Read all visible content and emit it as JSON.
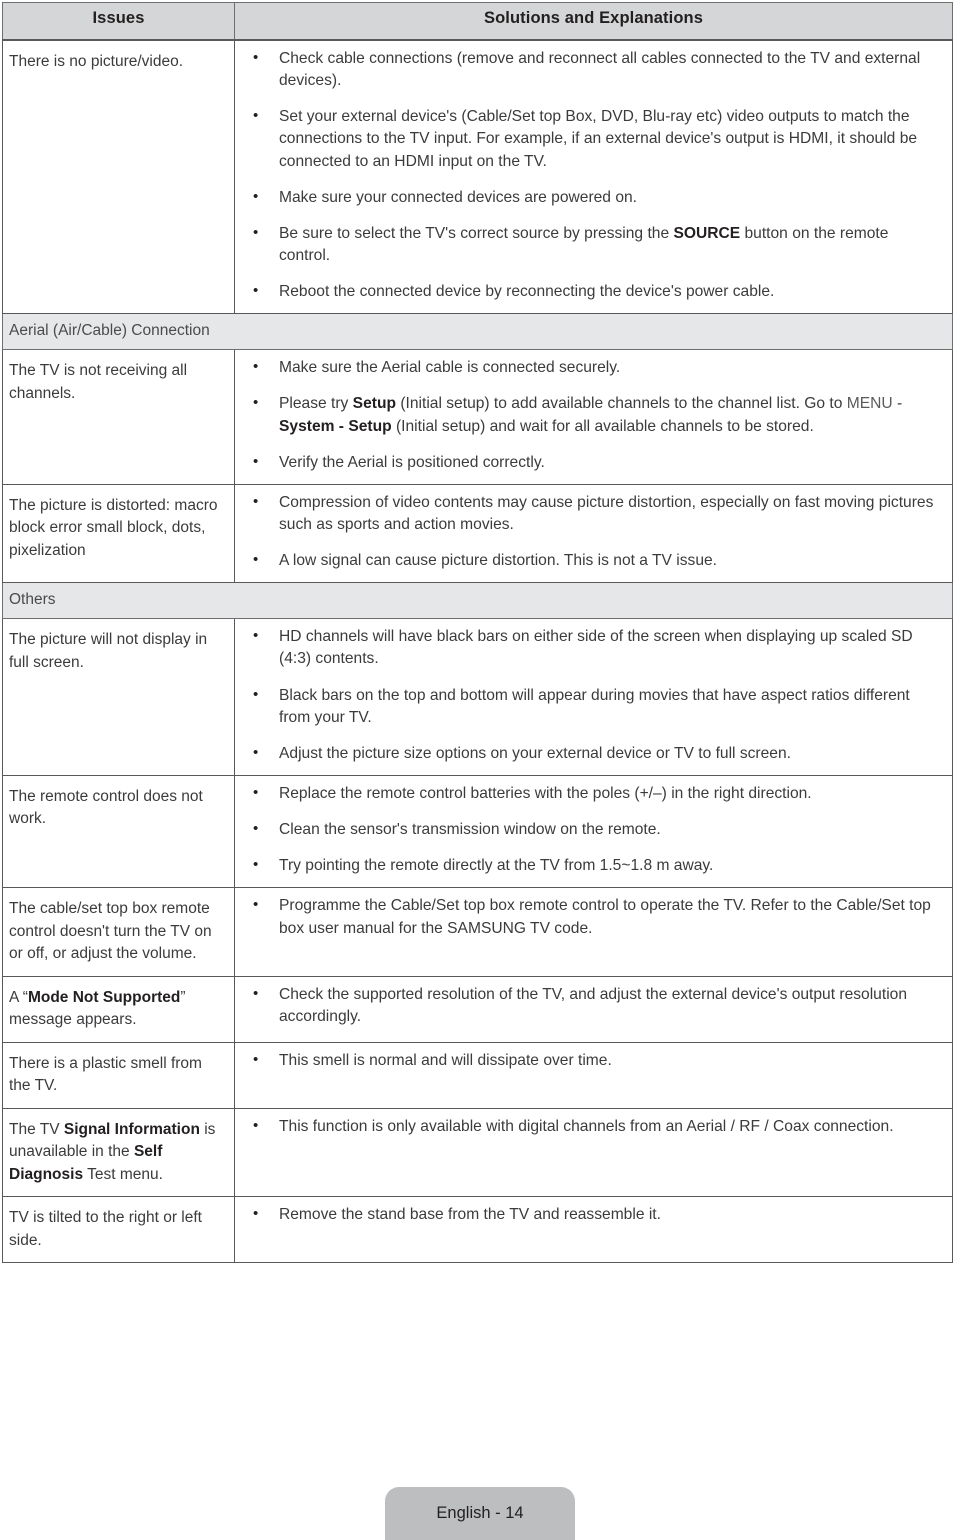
{
  "table": {
    "headers": {
      "issues": "Issues",
      "solutions": "Solutions and Explanations"
    },
    "sections": [
      {
        "label": "",
        "rows": [
          {
            "issue_parts": [
              {
                "text": "There is no picture/video.",
                "bold": false
              }
            ],
            "solutions": [
              [
                {
                  "text": "Check cable connections (remove and reconnect all cables connected to the TV and external devices).",
                  "style": "normal"
                }
              ],
              [
                {
                  "text": "Set your external device's (Cable/Set top Box, DVD, Blu-ray etc) video outputs to match the connections to the TV input. For example, if an external device's output is HDMI, it should be connected to an HDMI input on the TV.",
                  "style": "normal"
                }
              ],
              [
                {
                  "text": "Make sure your connected devices are powered on.",
                  "style": "normal"
                }
              ],
              [
                {
                  "text": "Be sure to select the TV's correct source by pressing the ",
                  "style": "normal"
                },
                {
                  "text": "SOURCE",
                  "style": "bold"
                },
                {
                  "text": " button on the remote control.",
                  "style": "normal"
                }
              ],
              [
                {
                  "text": "Reboot the connected device by reconnecting the device's power cable.",
                  "style": "normal"
                }
              ]
            ]
          }
        ]
      },
      {
        "label": "Aerial (Air/Cable) Connection",
        "rows": [
          {
            "issue_parts": [
              {
                "text": "The TV is not receiving all channels.",
                "bold": false
              }
            ],
            "solutions": [
              [
                {
                  "text": "Make sure the Aerial cable is connected securely.",
                  "style": "normal"
                }
              ],
              [
                {
                  "text": "Please try ",
                  "style": "normal"
                },
                {
                  "text": "Setup",
                  "style": "bold"
                },
                {
                  "text": " (Initial setup) to add available channels to the channel list. Go to ",
                  "style": "normal"
                },
                {
                  "text": "MENU",
                  "style": "light"
                },
                {
                  "text": " - ",
                  "style": "normal"
                },
                {
                  "text": "System - Setup",
                  "style": "bold"
                },
                {
                  "text": " (Initial setup) and wait for all available channels to be stored.",
                  "style": "normal"
                }
              ],
              [
                {
                  "text": "Verify the Aerial is positioned correctly.",
                  "style": "normal"
                }
              ]
            ]
          },
          {
            "issue_parts": [
              {
                "text": "The picture is distorted: macro block error small block, dots, pixelization",
                "bold": false
              }
            ],
            "solutions": [
              [
                {
                  "text": "Compression of video contents may cause picture distortion, especially on fast moving pictures such as sports and action movies.",
                  "style": "normal"
                }
              ],
              [
                {
                  "text": "A low signal can cause picture distortion. This is not a TV issue.",
                  "style": "normal"
                }
              ]
            ]
          }
        ]
      },
      {
        "label": "Others",
        "rows": [
          {
            "issue_parts": [
              {
                "text": "The picture will not display in full screen.",
                "bold": false
              }
            ],
            "solutions": [
              [
                {
                  "text": "HD channels will have black bars on either side of the screen when displaying up scaled SD (4:3) contents.",
                  "style": "normal"
                }
              ],
              [
                {
                  "text": "Black bars on the top and bottom will appear during movies that have aspect ratios different from your TV.",
                  "style": "normal"
                }
              ],
              [
                {
                  "text": "Adjust the picture size options on your external device or TV to full screen.",
                  "style": "normal"
                }
              ]
            ]
          },
          {
            "issue_parts": [
              {
                "text": "The remote control does not work.",
                "bold": false
              }
            ],
            "solutions": [
              [
                {
                  "text": "Replace the remote control batteries with the poles (+/–) in the right direction.",
                  "style": "normal"
                }
              ],
              [
                {
                  "text": "Clean the sensor's transmission window on the remote.",
                  "style": "normal"
                }
              ],
              [
                {
                  "text": "Try pointing the remote directly at the TV from 1.5~1.8 m away.",
                  "style": "normal"
                }
              ]
            ]
          },
          {
            "issue_parts": [
              {
                "text": "The cable/set top box remote control doesn't turn the TV on or off, or adjust the volume.",
                "bold": false
              }
            ],
            "solutions": [
              [
                {
                  "text": "Programme the Cable/Set top box remote control to operate the TV. Refer to the Cable/Set top box user manual for the SAMSUNG TV code.",
                  "style": "normal"
                }
              ]
            ]
          },
          {
            "issue_parts": [
              {
                "text": "A “",
                "bold": false
              },
              {
                "text": "Mode Not Supported",
                "bold": true
              },
              {
                "text": "” message appears.",
                "bold": false
              }
            ],
            "solutions": [
              [
                {
                  "text": "Check the supported resolution of the TV, and adjust the external device's output resolution accordingly.",
                  "style": "normal"
                }
              ]
            ]
          },
          {
            "issue_parts": [
              {
                "text": "There is a plastic smell from the TV.",
                "bold": false
              }
            ],
            "solutions": [
              [
                {
                  "text": "This smell is normal and will dissipate over time.",
                  "style": "normal"
                }
              ]
            ]
          },
          {
            "issue_parts": [
              {
                "text": "The TV ",
                "bold": false
              },
              {
                "text": "Signal Information",
                "bold": true
              },
              {
                "text": " is unavailable in the ",
                "bold": false
              },
              {
                "text": "Self Diagnosis",
                "bold": true
              },
              {
                "text": " Test menu.",
                "bold": false
              }
            ],
            "solutions": [
              [
                {
                  "text": "This function is only available with digital channels from an Aerial / RF / Coax connection.",
                  "style": "normal"
                }
              ]
            ]
          },
          {
            "issue_parts": [
              {
                "text": "TV is tilted to the right or left side.",
                "bold": false
              }
            ],
            "solutions": [
              [
                {
                  "text": "Remove the stand base from the TV and reassemble it.",
                  "style": "normal"
                }
              ]
            ]
          }
        ]
      }
    ]
  },
  "footer": {
    "page_label": "English - 14"
  },
  "colors": {
    "header_bg": "#d5d6d7",
    "section_bg": "#e6e7e8",
    "border": "#58595b",
    "text": "#3b3b3d",
    "footer_bg": "#bcbec0"
  }
}
